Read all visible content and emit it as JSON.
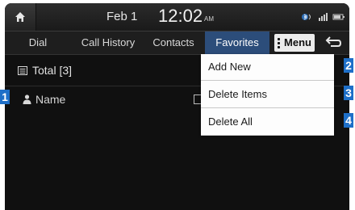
{
  "status_bar": {
    "date": "Feb  1",
    "time": "12:02",
    "ampm": "AM",
    "icons": [
      "home-icon",
      "bluetooth-icon",
      "signal-icon",
      "battery-icon"
    ]
  },
  "tabs": [
    {
      "label": "Dial",
      "active": false
    },
    {
      "label": "Call History",
      "active": false
    },
    {
      "label": "Contacts",
      "active": false
    },
    {
      "label": "Favorites",
      "active": true
    }
  ],
  "menu_button": {
    "label": "Menu"
  },
  "list": {
    "total_label": "Total [3]",
    "header_label": "Name"
  },
  "dropdown": {
    "items": [
      {
        "label": "Add New",
        "marker": "2"
      },
      {
        "label": "Delete Items",
        "marker": "3"
      },
      {
        "label": "Delete All",
        "marker": "4"
      }
    ]
  },
  "markers": {
    "name_marker": "1"
  },
  "colors": {
    "accent_tab": "#2c4d7a",
    "marker_blue": "#1e6fc8"
  }
}
